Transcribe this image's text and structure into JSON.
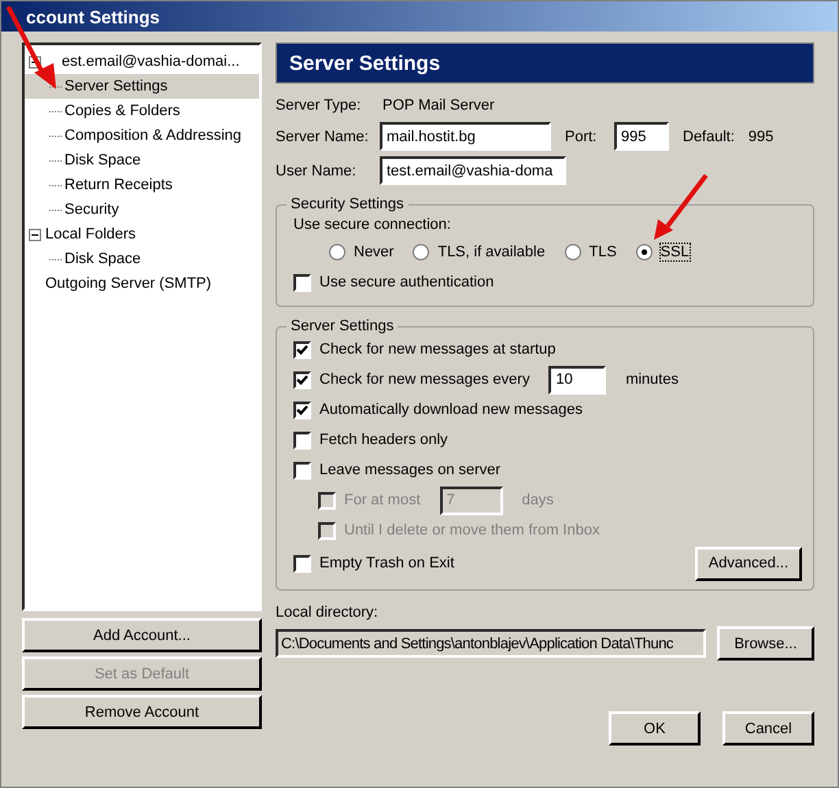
{
  "window": {
    "title": "ccount Settings"
  },
  "tree": [
    {
      "label": "est.email@vashia-domai...",
      "selected": false,
      "expanded": true,
      "children": [
        {
          "label": "Server Settings",
          "selected": true
        },
        {
          "label": "Copies & Folders",
          "selected": false
        },
        {
          "label": "Composition & Addressing",
          "selected": false
        },
        {
          "label": "Disk Space",
          "selected": false
        },
        {
          "label": "Return Receipts",
          "selected": false
        },
        {
          "label": "Security",
          "selected": false
        }
      ]
    },
    {
      "label": "Local Folders",
      "selected": false,
      "expanded": true,
      "children": [
        {
          "label": "Disk Space",
          "selected": false
        }
      ]
    },
    {
      "label": "Outgoing Server (SMTP)",
      "selected": false
    }
  ],
  "account_buttons": [
    {
      "label": "Add Account...",
      "disabled": false
    },
    {
      "label": "Set as Default",
      "disabled": true
    },
    {
      "label": "Remove Account",
      "disabled": false
    }
  ],
  "header": "Server Settings",
  "server_type": {
    "label": "Server Type:",
    "value": "POP Mail Server"
  },
  "server_name": {
    "label": "Server Name:",
    "value": "mail.hostit.bg"
  },
  "port": {
    "label": "Port:",
    "value": "995"
  },
  "default_port": {
    "label": "Default:",
    "value": "995"
  },
  "user_name": {
    "label": "User Name:",
    "value": "test.email@vashia-doma"
  },
  "security": {
    "title": "Security Settings",
    "connection_label": "Use secure connection:",
    "options": [
      {
        "label": "Never",
        "selected": false
      },
      {
        "label": "TLS, if available",
        "selected": false
      },
      {
        "label": "TLS",
        "selected": false
      },
      {
        "label": "SSL",
        "selected": true
      }
    ],
    "secure_auth": {
      "label": "Use secure authentication",
      "checked": false
    }
  },
  "server_settings": {
    "title": "Server Settings",
    "items": [
      {
        "label": "Check for new messages at startup",
        "checked": true,
        "disabled": false
      },
      {
        "label": "Check for new messages every",
        "checked": true,
        "disabled": false,
        "value": "10",
        "unit": "minutes"
      },
      {
        "label": "Automatically download new messages",
        "checked": true,
        "disabled": false
      },
      {
        "label": "Fetch headers only",
        "checked": false,
        "disabled": false
      },
      {
        "label": "Leave messages on server",
        "checked": false,
        "disabled": false,
        "children": [
          {
            "label": "For at most",
            "checked": false,
            "disabled": true,
            "value": "7",
            "unit": "days"
          },
          {
            "label": "Until I delete or move them from Inbox",
            "checked": false,
            "disabled": true
          }
        ]
      }
    ],
    "last": {
      "label": "Empty Trash on Exit",
      "checked": false,
      "disabled": false
    },
    "advanced": "Advanced..."
  },
  "local_directory": {
    "label": "Local directory:",
    "value": "C:\\Documents and Settings\\antonblajev\\Application Data\\Thunc",
    "browse": "Browse..."
  },
  "buttons": [
    "OK",
    "Cancel"
  ]
}
